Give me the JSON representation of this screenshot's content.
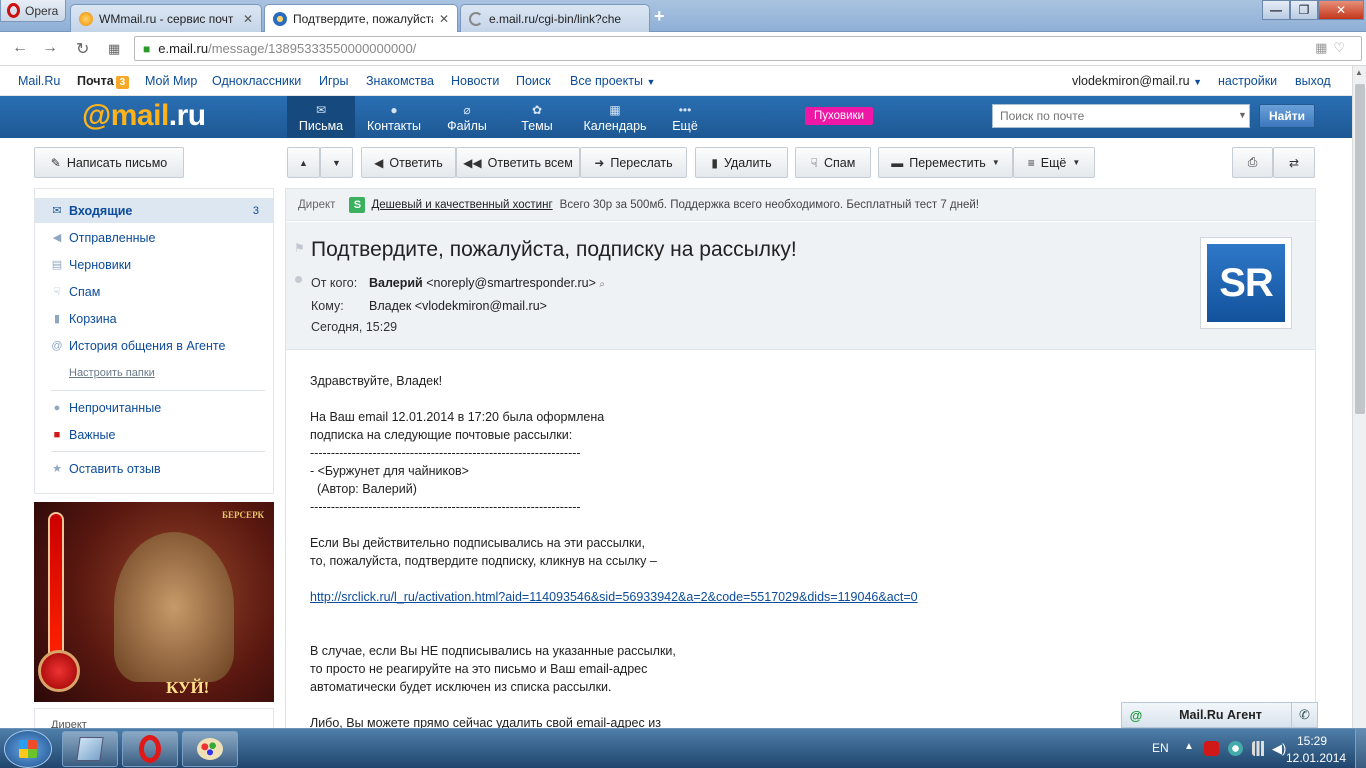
{
  "browser": {
    "menu_label": "Opera",
    "tabs": [
      {
        "title": "WMmail.ru - сервис почт",
        "favicon": "wmmail-favicon"
      },
      {
        "title": "Подтвердите, пожалуйста",
        "favicon": "mail-favicon",
        "active": true
      },
      {
        "title": "e.mail.ru/cgi-bin/link?che",
        "favicon": "loading-favicon"
      }
    ],
    "url_host": "e.mail.ru",
    "url_path": "/message/13895333550000000000/"
  },
  "portal": {
    "mailru": "Mail.Ru",
    "pochta": "Почта",
    "pochta_count": "3",
    "moy_mir": "Мой Мир",
    "ok": "Одноклассники",
    "games": "Игры",
    "dating": "Знакомства",
    "news": "Новости",
    "search": "Поиск",
    "all_projects": "Все проекты",
    "user": "vlodekmiron@mail.ru",
    "settings": "настройки",
    "logout": "выход"
  },
  "header": {
    "logo_at": "@mail",
    "logo_dom": ".ru",
    "nav": {
      "letters": "Письма",
      "contacts": "Контакты",
      "files": "Файлы",
      "themes": "Темы",
      "calendar": "Календарь",
      "more": "Ещё"
    },
    "promo": "Пуховики",
    "search_placeholder": "Поиск по почте",
    "search_button": "Найти"
  },
  "toolbar": {
    "compose": "Написать письмо",
    "reply": "Ответить",
    "reply_all": "Ответить всем",
    "forward": "Переслать",
    "delete": "Удалить",
    "spam": "Спам",
    "move": "Переместить",
    "more": "Ещё"
  },
  "sidebar": {
    "inbox": "Входящие",
    "inbox_count": "3",
    "sent": "Отправленные",
    "drafts": "Черновики",
    "spam": "Спам",
    "trash": "Корзина",
    "agent_history": "История общения в Агенте",
    "configure": "Настроить папки",
    "unread": "Непрочитанные",
    "important": "Важные",
    "feedback": "Оставить отзыв"
  },
  "ad": {
    "game": "БЕРСЕРК",
    "cta": "КУЙ!",
    "direct_label": "Директ"
  },
  "direct": {
    "label": "Директ",
    "icon_letter": "S",
    "link": "Дешевый и качественный хостинг",
    "text": "Всего 30р за 500мб. Поддержка всего необходимого. Бесплатный тест 7 дней!"
  },
  "message": {
    "subject": "Подтвердите, пожалуйста, подписку на рассылку!",
    "from_label": "От кого:",
    "from_name": "Валерий",
    "from_email": "<noreply@smartresponder.ru>",
    "to_label": "Кому:",
    "to_value": "Владек <vlodekmiron@mail.ru>",
    "date": "Сегодня, 15:29",
    "avatar_text": "SR",
    "body": {
      "greeting": "Здравствуйте, Владек!",
      "p1_l1": "На Ваш email 12.01.2014 в 17:20 была оформлена",
      "p1_l2": "подписка на следующие почтовые рассылки:",
      "dashes": "-----------------------------------------------------------------",
      "item": "- <Буржунет для чайников>",
      "author": "  (Автор: Валерий)",
      "p2_l1": "Если Вы действительно подписывались на эти рассылки,",
      "p2_l2": "то, пожалуйста, подтвердите подписку, кликнув на ссылку –",
      "link": "http://srclick.ru/l_ru/activation.html?aid=114093546&sid=56933942&a=2&code=5517029&dids=119046&act=0",
      "p3_l1": "В случае, если Вы НЕ подписывались на указанные рассылки,",
      "p3_l2": "то просто не реагируйте на это письмо и Ваш email-адрес",
      "p3_l3": "автоматически будет исключен из списка рассылки.",
      "p4_l1": "Либо, Вы можете прямо сейчас удалить свой email-адрес из"
    }
  },
  "agent": {
    "name": "Mail.Ru Агент"
  },
  "taskbar": {
    "lang": "EN",
    "time": "15:29",
    "date": "12.01.2014"
  }
}
